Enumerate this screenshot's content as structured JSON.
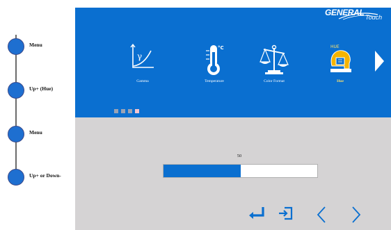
{
  "steps": [
    {
      "label": "Menu"
    },
    {
      "label": "Up+ (Hue)"
    },
    {
      "label": "Menu"
    },
    {
      "label": "Up+ or Down-"
    }
  ],
  "brand": {
    "name": "GENERAL",
    "sub": "Touch"
  },
  "menu": {
    "items": [
      {
        "label": "Gamma",
        "icon": "gamma-icon",
        "symbol": "γ"
      },
      {
        "label": "Temperature",
        "icon": "thermometer-icon",
        "symbol": "°C"
      },
      {
        "label": "Color Format",
        "icon": "scale-icon"
      },
      {
        "label": "Hue",
        "icon": "hue-icon",
        "badge": "HUE",
        "active": true
      }
    ],
    "page_count": 4,
    "current_page": 4
  },
  "slider": {
    "value": "50",
    "level_percent": 50
  },
  "colors": {
    "osd_blue": "#0a6fd0",
    "osd_gray": "#d5d3d4",
    "active_label": "#ffe36a",
    "step_circle": "#1e6fd0"
  }
}
